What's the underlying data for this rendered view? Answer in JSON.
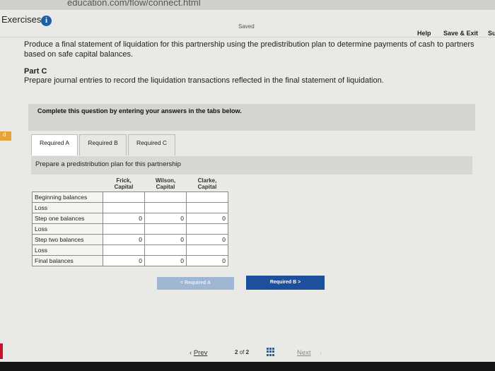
{
  "browser": {
    "url_fragment": "education.com/flow/connect.html"
  },
  "header": {
    "section": "Exercises",
    "saved_status": "Saved",
    "help": "Help",
    "save_exit": "Save & Exit",
    "submit_partial": "Su"
  },
  "question": {
    "intro": "Produce a final statement of liquidation for this partnership using the predistribution plan to determine payments of cash to partners based on safe capital balances.",
    "part_title": "Part C",
    "part_text": "Prepare journal entries to record the liquidation transactions reflected in the final statement of liquidation.",
    "instructions": "Complete this question by entering your answers in the tabs below."
  },
  "left_marker": "d",
  "tabs": [
    {
      "label": "Required A"
    },
    {
      "label": "Required B"
    },
    {
      "label": "Required C"
    }
  ],
  "panel": {
    "title": "Prepare a predistribution plan for this partnership"
  },
  "table": {
    "headers": [
      "Frick,\nCapital",
      "Wilson,\nCapital",
      "Clarke,\nCapital"
    ],
    "rows": [
      {
        "label": "Beginning balances",
        "values": [
          "",
          "",
          ""
        ]
      },
      {
        "label": "Loss",
        "values": [
          "",
          "",
          ""
        ]
      },
      {
        "label": "Step one balances",
        "values": [
          "0",
          "0",
          "0"
        ]
      },
      {
        "label": "Loss",
        "values": [
          "",
          "",
          ""
        ]
      },
      {
        "label": "Step two balances",
        "values": [
          "0",
          "0",
          "0"
        ]
      },
      {
        "label": "Loss",
        "values": [
          "",
          "",
          ""
        ]
      },
      {
        "label": "Final balances",
        "values": [
          "0",
          "0",
          "0"
        ]
      }
    ]
  },
  "nav_buttons": {
    "prev_required": "< Required A",
    "next_required": "Required B  >"
  },
  "pager": {
    "prev": "Prev",
    "current": "2",
    "of": "of",
    "total": "2",
    "next": "Next"
  }
}
